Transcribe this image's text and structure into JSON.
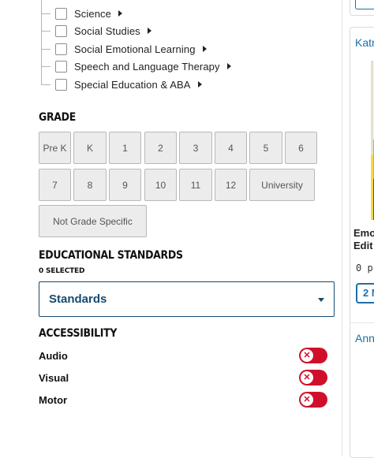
{
  "subjects": [
    {
      "label": "Science"
    },
    {
      "label": "Social Studies"
    },
    {
      "label": "Social Emotional Learning"
    },
    {
      "label": "Speech and Language Therapy"
    },
    {
      "label": "Special Education & ABA"
    }
  ],
  "grade": {
    "heading": "GRADE",
    "buttons": [
      "Pre K",
      "K",
      "1",
      "2",
      "3",
      "4",
      "5",
      "6",
      "7",
      "8",
      "9",
      "10",
      "11",
      "12",
      "University",
      "Not Grade Specific"
    ]
  },
  "standards": {
    "heading": "EDUCATIONAL STANDARDS",
    "selected_count": "0 SELECTED",
    "select_label": "Standards"
  },
  "accessibility": {
    "heading": "ACCESSIBILITY",
    "options": [
      {
        "label": "Audio",
        "enabled": false
      },
      {
        "label": "Visual",
        "enabled": false
      },
      {
        "label": "Motor",
        "enabled": false
      }
    ]
  },
  "results": {
    "card1": {
      "author": "Katr",
      "title_line1": "Emo",
      "title_line2": "Edit",
      "price": "0 p",
      "cta": "2 M"
    },
    "card2": {
      "author": "Ann"
    }
  },
  "colors": {
    "accent": "#174a6f",
    "link": "#1d6fa8",
    "toggle_off": "#d0102a",
    "grade_bg": "#ececec"
  }
}
